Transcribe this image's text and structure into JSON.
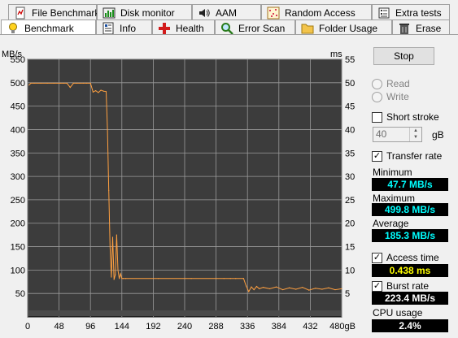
{
  "tabs_row1": [
    {
      "label": "File Benchmark",
      "icon": "file-benchmark-icon"
    },
    {
      "label": "Disk monitor",
      "icon": "disk-monitor-icon"
    },
    {
      "label": "AAM",
      "icon": "speaker-icon"
    },
    {
      "label": "Random Access",
      "icon": "random-access-icon"
    },
    {
      "label": "Extra tests",
      "icon": "extra-tests-icon"
    }
  ],
  "tabs_row2": [
    {
      "label": "Benchmark",
      "icon": "lightbulb-icon",
      "active": true
    },
    {
      "label": "Info",
      "icon": "info-icon"
    },
    {
      "label": "Health",
      "icon": "health-cross-icon"
    },
    {
      "label": "Error Scan",
      "icon": "magnifier-icon"
    },
    {
      "label": "Folder Usage",
      "icon": "folder-icon"
    },
    {
      "label": "Erase",
      "icon": "trash-icon"
    }
  ],
  "controls": {
    "stop_label": "Stop",
    "read_label": "Read",
    "write_label": "Write",
    "short_stroke_label": "Short stroke",
    "stroke_value": "40",
    "stroke_unit": "gB",
    "transfer_rate_label": "Transfer rate",
    "access_time_label": "Access time",
    "burst_rate_label": "Burst rate"
  },
  "stats": {
    "minimum_label": "Minimum",
    "minimum_value": "47.7 MB/s",
    "maximum_label": "Maximum",
    "maximum_value": "499.8 MB/s",
    "average_label": "Average",
    "average_value": "185.3 MB/s",
    "access_time_value": "0.438 ms",
    "burst_rate_value": "223.4 MB/s",
    "cpu_label": "CPU usage",
    "cpu_value": "2.4%"
  },
  "colors": {
    "plot_bg": "#3c3c3c",
    "grid": "#9a9a9a",
    "transfer_line": "#ffa040",
    "value_bg": "#000000"
  },
  "chart_data": {
    "type": "line",
    "ylabel": "MB/s",
    "y2label": "ms",
    "xlabel_unit": "gB",
    "xlim": [
      0,
      480
    ],
    "ylim": [
      0,
      550
    ],
    "y2lim": [
      0,
      55
    ],
    "x_ticks": [
      "0",
      "48",
      "96",
      "144",
      "192",
      "240",
      "288",
      "336",
      "384",
      "432",
      "480gB"
    ],
    "y_ticks": [
      "50",
      "100",
      "150",
      "200",
      "250",
      "300",
      "350",
      "400",
      "450",
      "500",
      "550"
    ],
    "y2_ticks": [
      "5",
      "10",
      "15",
      "20",
      "25",
      "30",
      "35",
      "40",
      "45",
      "50",
      "55"
    ],
    "grid": true,
    "series": [
      {
        "name": "Transfer rate",
        "color": "#ffa040",
        "x": [
          2,
          5,
          10,
          20,
          30,
          40,
          50,
          55,
          60,
          65,
          70,
          75,
          80,
          85,
          90,
          96,
          100,
          104,
          108,
          112,
          116,
          120,
          122,
          124,
          126,
          128,
          130,
          132,
          134,
          136,
          138,
          140,
          142,
          144,
          146,
          150,
          200,
          250,
          300,
          310,
          318,
          330,
          334,
          338,
          342,
          346,
          350,
          354,
          360,
          370,
          380,
          390,
          400,
          410,
          420,
          430,
          440,
          450,
          460,
          470,
          480
        ],
        "y": [
          495,
          499,
          499,
          499,
          499,
          499,
          499,
          499,
          499,
          490,
          499,
          499,
          499,
          499,
          499,
          499,
          480,
          483,
          479,
          484,
          482,
          481,
          400,
          270,
          150,
          85,
          170,
          80,
          90,
          175,
          100,
          82,
          92,
          82,
          82,
          82,
          82,
          82,
          82,
          82,
          82,
          82,
          66,
          54,
          64,
          58,
          65,
          60,
          63,
          60,
          64,
          58,
          62,
          59,
          63,
          57,
          61,
          59,
          62,
          58,
          60
        ]
      }
    ]
  }
}
